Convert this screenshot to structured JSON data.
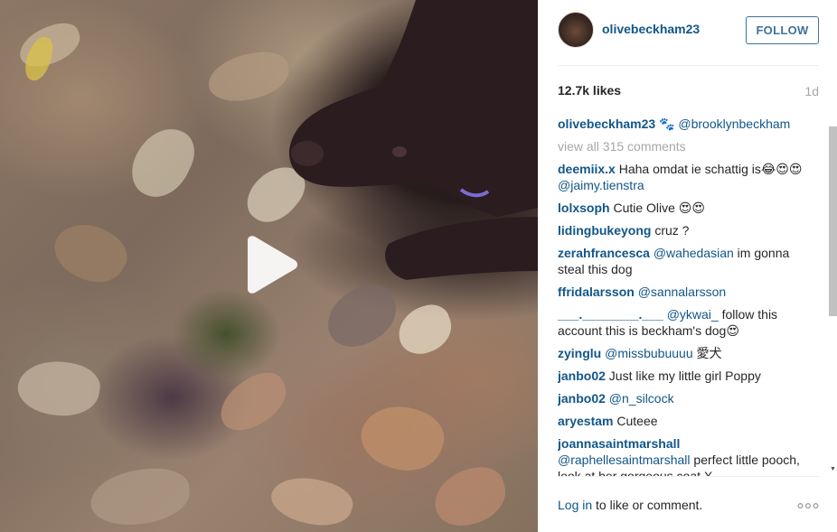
{
  "post": {
    "username": "olivebeckham23",
    "follow_label": "FOLLOW",
    "likes": "12.7k likes",
    "time_ago": "1d",
    "view_all_comments": "view all 315 comments"
  },
  "comments": [
    {
      "user": "olivebeckham23",
      "parts": [
        {
          "text": " 🐾 "
        },
        {
          "mention": "@brooklynbeckham"
        }
      ]
    },
    {
      "user": "deemiix.x",
      "parts": [
        {
          "text": " Haha omdat ie schattig is😂😍😍 "
        },
        {
          "mention": "@jaimy.tienstra"
        }
      ]
    },
    {
      "user": "lolxsoph",
      "parts": [
        {
          "text": " Cutie Olive 😍😍"
        }
      ]
    },
    {
      "user": "lidingbukeyong",
      "parts": [
        {
          "text": " cruz ?"
        }
      ]
    },
    {
      "user": "zerahfrancesca",
      "parts": [
        {
          "text": " "
        },
        {
          "mention": "@wahedasian"
        },
        {
          "text": " im gonna steal this dog"
        }
      ]
    },
    {
      "user": "ffridalarsson",
      "parts": [
        {
          "text": " "
        },
        {
          "mention": "@sannalarsson"
        }
      ]
    },
    {
      "user": "___.________.___",
      "parts": [
        {
          "text": " "
        },
        {
          "mention": "@ykwai_"
        },
        {
          "text": " follow this account this is beckham's dog😍"
        }
      ]
    },
    {
      "user": "zyinglu",
      "parts": [
        {
          "text": " "
        },
        {
          "mention": "@missbubuuuu"
        },
        {
          "text": " 愛犬"
        }
      ]
    },
    {
      "user": "janbo02",
      "parts": [
        {
          "text": " Just like my little girl Poppy"
        }
      ]
    },
    {
      "user": "janbo02",
      "parts": [
        {
          "text": " "
        },
        {
          "mention": "@n_silcock"
        }
      ]
    },
    {
      "user": "aryestam",
      "parts": [
        {
          "text": " Cuteee"
        }
      ]
    },
    {
      "user": "joannasaintmarshall",
      "parts": [
        {
          "text": " "
        },
        {
          "mention": "@raphellesaintmarshall"
        },
        {
          "text": " perfect little pooch, look at her gorgeous coat X"
        }
      ]
    }
  ],
  "footer": {
    "login_link": "Log in",
    "login_rest": " to like or comment."
  },
  "icons": {
    "play": "play-icon",
    "more": "more-options-icon",
    "scroll_down": "scroll-down-arrow"
  },
  "colors": {
    "link": "#125688",
    "follow_border": "#3f729b",
    "muted": "#a5a7aa"
  }
}
